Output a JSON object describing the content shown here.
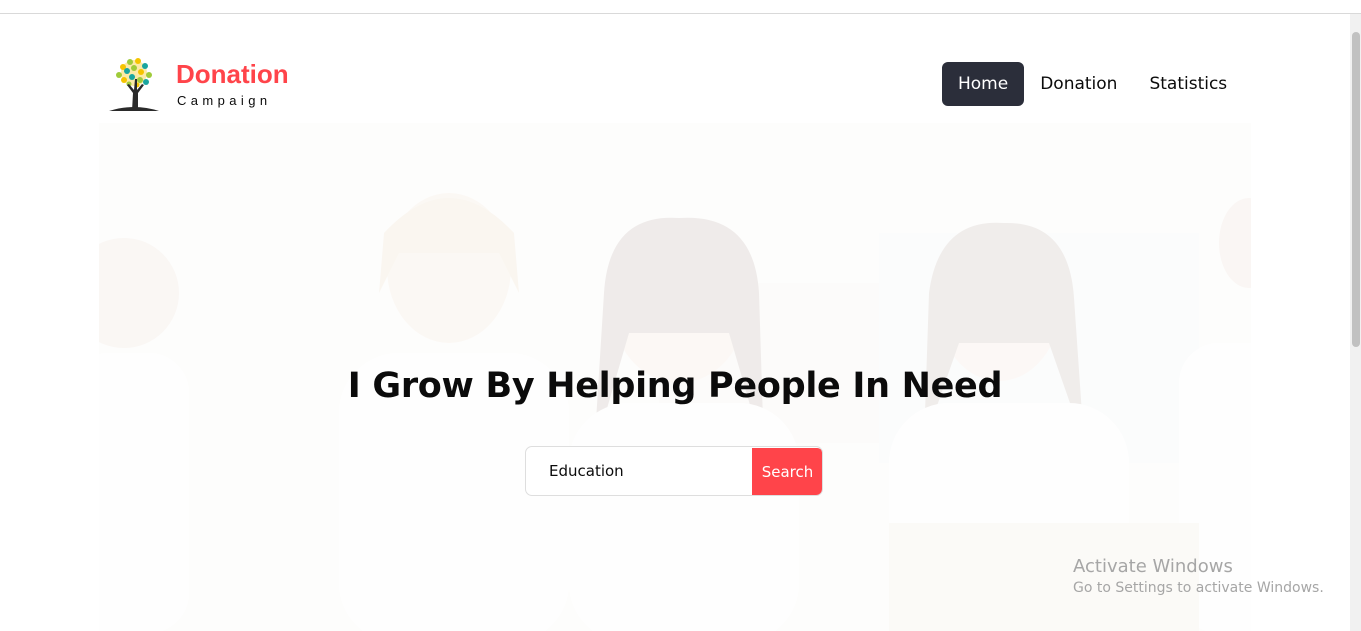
{
  "brand": {
    "title": "Donation",
    "subtitle": "Campaign",
    "accent_color": "#ff444a",
    "logo_icon": "tree-icon"
  },
  "nav": {
    "items": [
      {
        "label": "Home",
        "active": true
      },
      {
        "label": "Donation",
        "active": false
      },
      {
        "label": "Statistics",
        "active": false
      }
    ],
    "active_bg": "#2b2e3a"
  },
  "hero": {
    "title": "I Grow By Helping People In Need",
    "background_image": "volunteers-photo",
    "search": {
      "value": "Education",
      "button_label": "Search"
    }
  },
  "system_watermark": {
    "title": "Activate Windows",
    "subtitle": "Go to Settings to activate Windows."
  }
}
